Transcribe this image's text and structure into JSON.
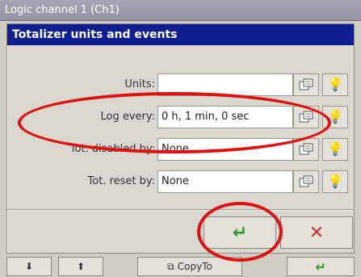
{
  "window": {
    "title": "Logic channel 1 (Ch1)"
  },
  "dialog": {
    "title": "Totalizer units and events",
    "rows": [
      {
        "label": "Units:",
        "value": "",
        "edit_icon": "edit-icon",
        "light_icon": "lightbulb-icon",
        "light_state": "off"
      },
      {
        "label": "Log every:",
        "value": "0 h, 1 min, 0 sec",
        "edit_icon": "edit-icon",
        "light_icon": "lightbulb-icon",
        "light_state": "on"
      },
      {
        "label": "Tot. disabled by:",
        "value": "None",
        "edit_icon": "edit-icon",
        "light_icon": "lightbulb-icon",
        "light_state": "on"
      },
      {
        "label": "Tot. reset by:",
        "value": "None",
        "edit_icon": "edit-icon",
        "light_icon": "lightbulb-icon",
        "light_state": "on"
      }
    ],
    "ok_icon": "enter-icon",
    "cancel_icon": "close-icon"
  },
  "toolbar": {
    "copy_label": "CopyTo",
    "down_icon": "arrow-down-icon",
    "up_icon": "arrow-up-icon",
    "enter_icon": "enter-icon"
  },
  "colors": {
    "title_bar": "#0f1f92",
    "annotation": "#e01010",
    "ok_green": "#2e9a2e",
    "cancel_red": "#d12b2b"
  }
}
